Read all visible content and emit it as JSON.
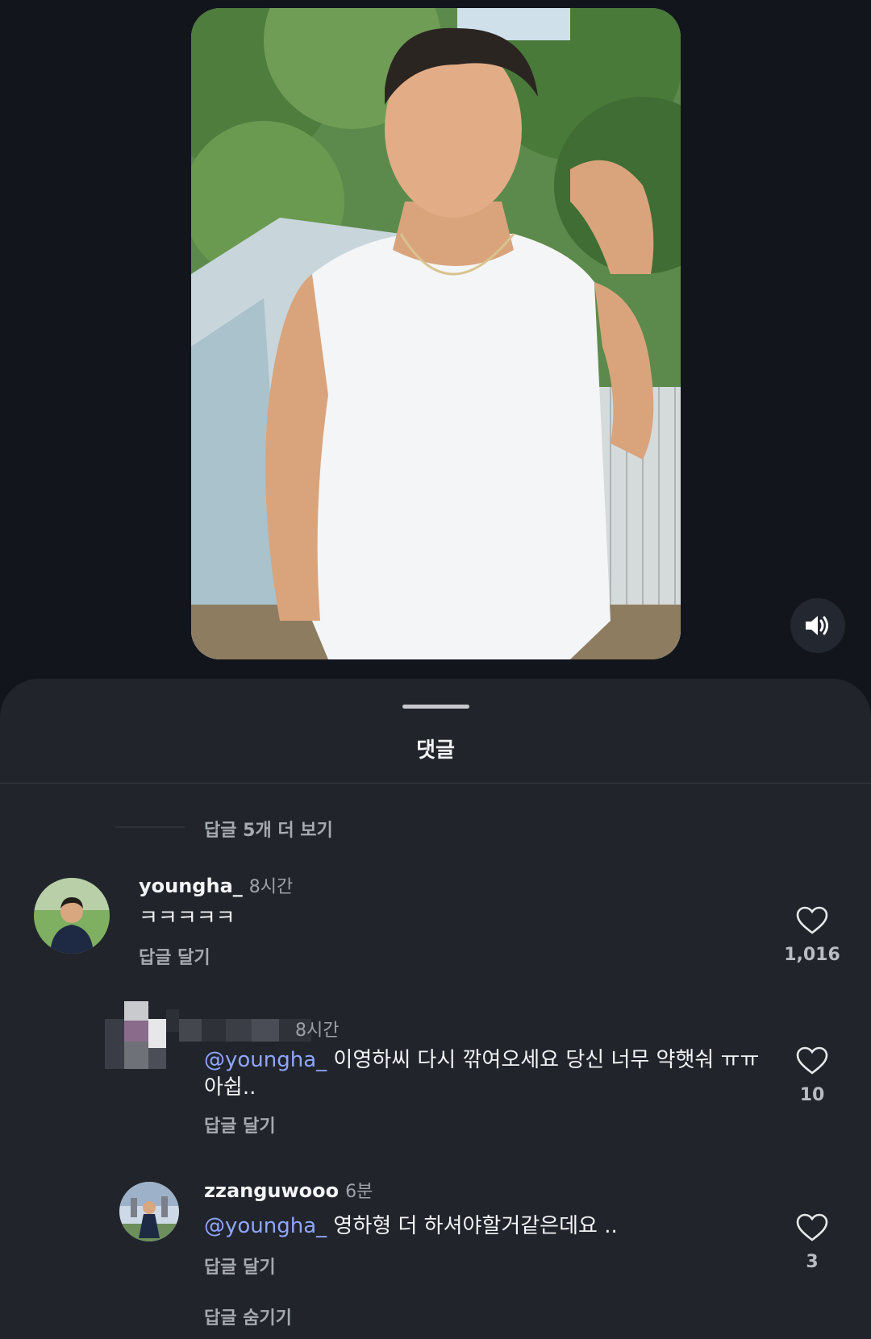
{
  "sound_icon": "speaker-on-icon",
  "sheet": {
    "title": "댓글",
    "view_more_replies": "답글 5개 더 보기",
    "hide_replies": "답글 숨기기"
  },
  "comments": [
    {
      "author": "youngha_",
      "time": "8시간",
      "text": "ㅋㅋㅋㅋㅋ",
      "reply_label": "답글 달기",
      "likes": "1,016"
    },
    {
      "author": "",
      "time": "8시간",
      "mention": "@youngha_",
      "text": " 이영하씨 다시 깎여오세요 당신 너무 약햇숴 ㅠㅠ 아쉽..",
      "reply_label": "답글 달기",
      "likes": "10"
    },
    {
      "author": "zzanguwooo",
      "time": "6분",
      "mention": "@youngha_",
      "text": " 영하형 더 하셔야할거같은데요 ..",
      "reply_label": "답글 달기",
      "likes": "3"
    }
  ],
  "colors": {
    "background": "#12151c",
    "sheet": "#21242b",
    "mention": "#8fa7ff",
    "secondary_text": "#a6aab1"
  }
}
